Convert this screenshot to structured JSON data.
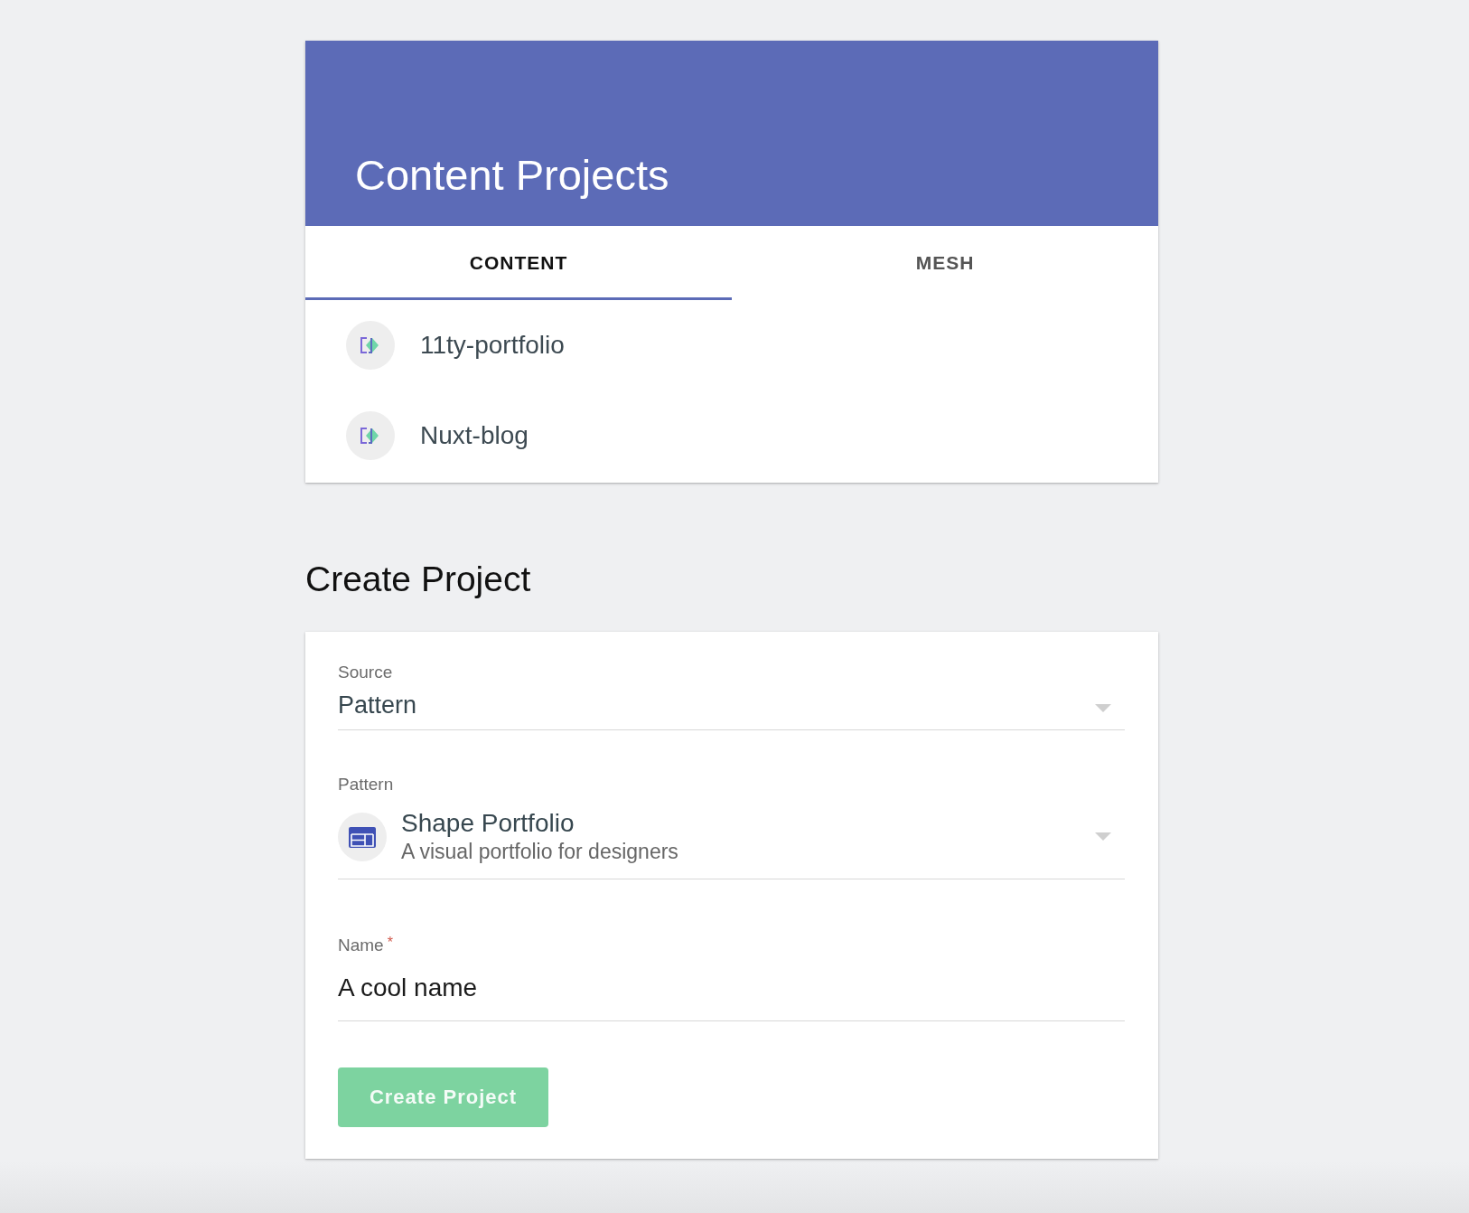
{
  "header": {
    "title": "Content Projects"
  },
  "tabs": [
    {
      "label": "CONTENT",
      "selected": true
    },
    {
      "label": "MESH",
      "selected": false
    }
  ],
  "projects": [
    {
      "name": "11ty-portfolio"
    },
    {
      "name": "Nuxt-blog"
    }
  ],
  "create": {
    "heading": "Create Project",
    "fields": [
      {
        "kind": "select",
        "label": "Source",
        "value": "Pattern"
      },
      {
        "kind": "pattern_select",
        "label": "Pattern",
        "value": "Shape Portfolio",
        "description": "A visual portfolio for designers"
      },
      {
        "kind": "text",
        "label": "Name",
        "required_mark": "*",
        "value": "A cool name"
      }
    ],
    "button": {
      "label": "Create Project"
    }
  }
}
